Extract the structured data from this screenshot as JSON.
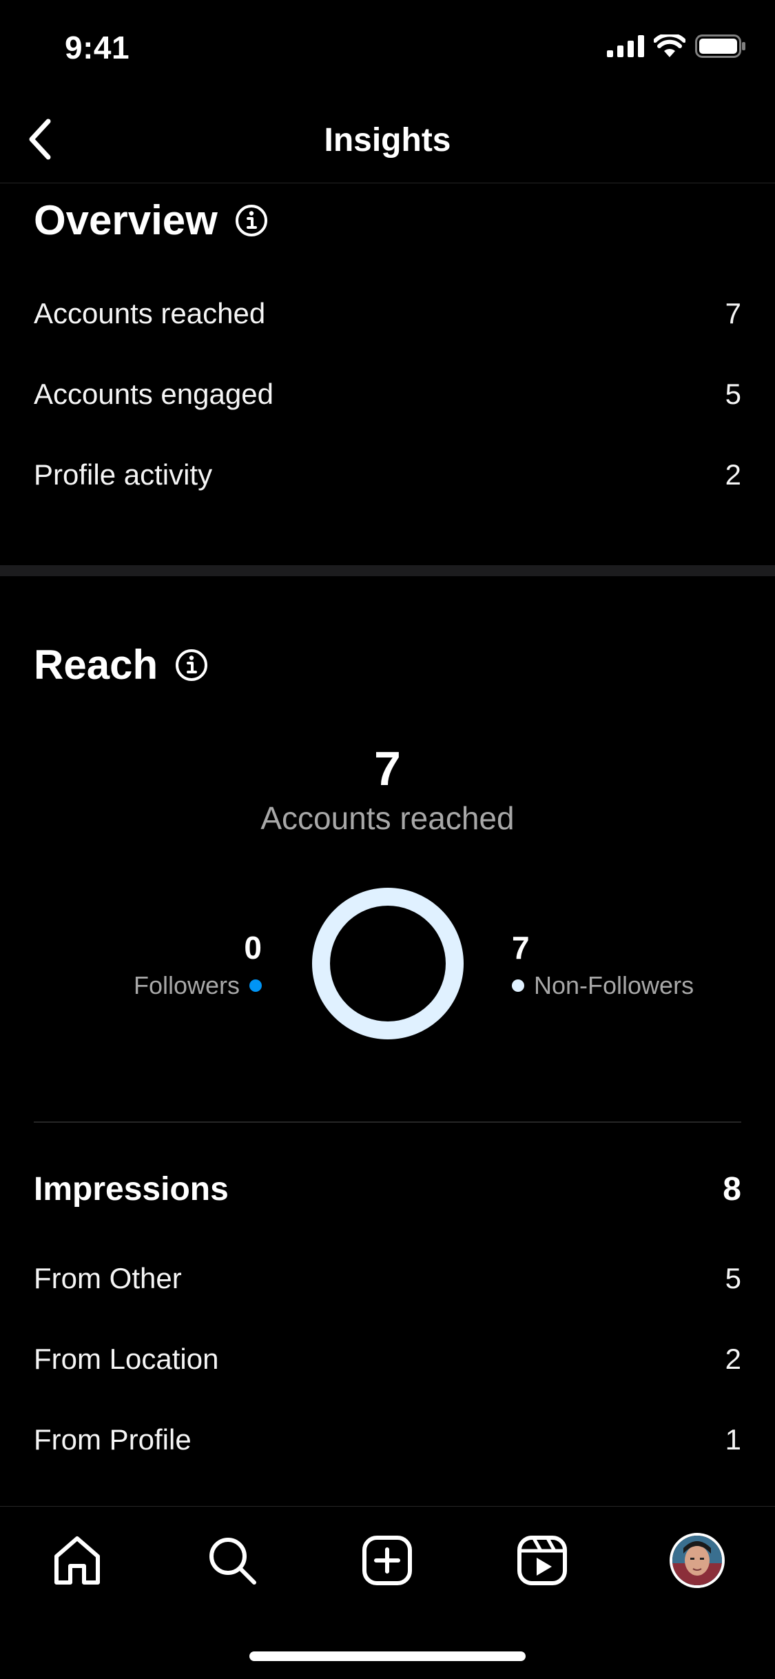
{
  "status_bar": {
    "time": "9:41"
  },
  "nav": {
    "title": "Insights",
    "back_icon": "chevron-left-icon"
  },
  "overview": {
    "title": "Overview",
    "rows": [
      {
        "label": "Accounts reached",
        "value": "7"
      },
      {
        "label": "Accounts engaged",
        "value": "5"
      },
      {
        "label": "Profile activity",
        "value": "2"
      }
    ]
  },
  "reach": {
    "title": "Reach",
    "count": "7",
    "count_label": "Accounts reached",
    "followers": {
      "value": "0",
      "label": "Followers",
      "color": "#0095f6"
    },
    "non_followers": {
      "value": "7",
      "label": "Non-Followers",
      "color": "#e0f1ff"
    }
  },
  "impressions": {
    "title": "Impressions",
    "total": "8",
    "rows": [
      {
        "label": "From Other",
        "value": "5"
      },
      {
        "label": "From Location",
        "value": "2"
      },
      {
        "label": "From Profile",
        "value": "1"
      }
    ]
  },
  "tab_bar": {
    "items": [
      "home-icon",
      "search-icon",
      "create-post-icon",
      "reels-icon",
      "profile-avatar"
    ]
  }
}
